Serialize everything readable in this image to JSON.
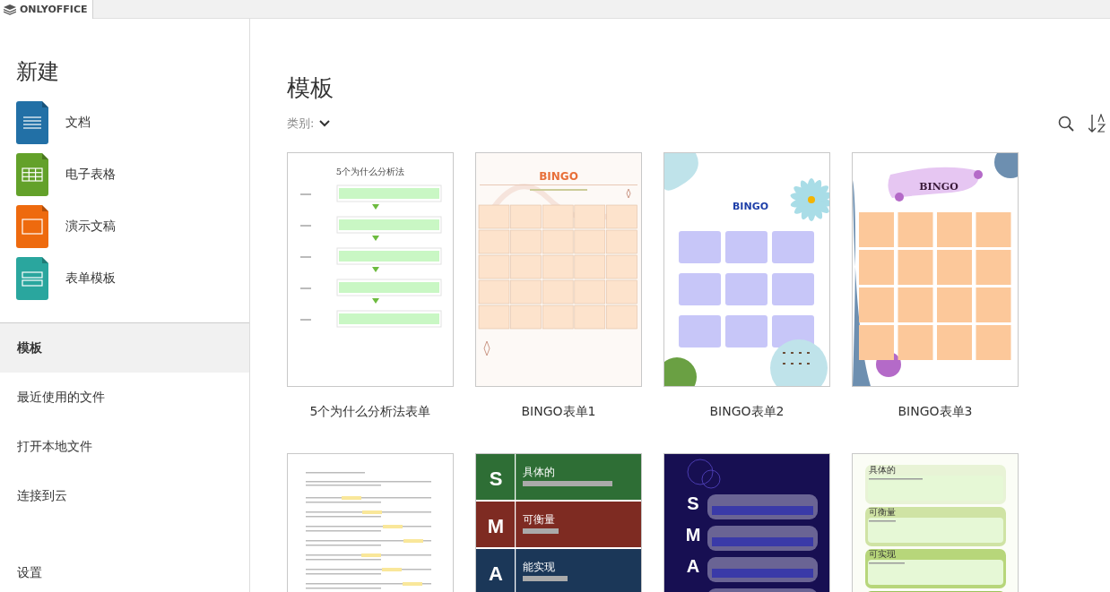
{
  "app": {
    "tab_title": "ONLYOFFICE"
  },
  "sidebar": {
    "heading": "新建",
    "create_items": [
      {
        "kind": "document",
        "label": "文档"
      },
      {
        "kind": "spreadsheet",
        "label": "电子表格"
      },
      {
        "kind": "presentation",
        "label": "演示文稿"
      },
      {
        "kind": "form",
        "label": "表单模板"
      }
    ],
    "menu": [
      {
        "label": "模板",
        "selected": true
      },
      {
        "label": "最近使用的文件",
        "selected": false
      },
      {
        "label": "打开本地文件",
        "selected": false
      },
      {
        "label": "连接到云",
        "selected": false
      }
    ],
    "settings": "设置"
  },
  "main": {
    "title": "模板",
    "category_label": "类别:",
    "templates": [
      {
        "name": "5个为什么分析法表单",
        "preview": {
          "kind": "why5",
          "title": "5个为什么分析法"
        }
      },
      {
        "name": "BINGO表单1",
        "preview": {
          "kind": "bingo-peach",
          "title": "BINGO"
        }
      },
      {
        "name": "BINGO表单2",
        "preview": {
          "kind": "bingo-flower",
          "title": "BINGO"
        }
      },
      {
        "name": "BINGO表单3",
        "preview": {
          "kind": "bingo-purple",
          "title": "BINGO"
        }
      },
      {
        "preview": {
          "kind": "text-doc"
        }
      },
      {
        "preview": {
          "kind": "smart-bands",
          "rows": [
            {
              "letter": "S",
              "heading": "具体的",
              "color": "#2e6e35"
            },
            {
              "letter": "M",
              "heading": "可衡量",
              "color": "#7e2b22"
            },
            {
              "letter": "A",
              "heading": "能实现",
              "color": "#1b3758"
            }
          ]
        }
      },
      {
        "preview": {
          "kind": "smart-dark",
          "letters": [
            "S",
            "M",
            "A"
          ]
        }
      },
      {
        "preview": {
          "kind": "smart-green",
          "headings": [
            "具体的",
            "可衡量",
            "可实现"
          ]
        }
      }
    ]
  }
}
